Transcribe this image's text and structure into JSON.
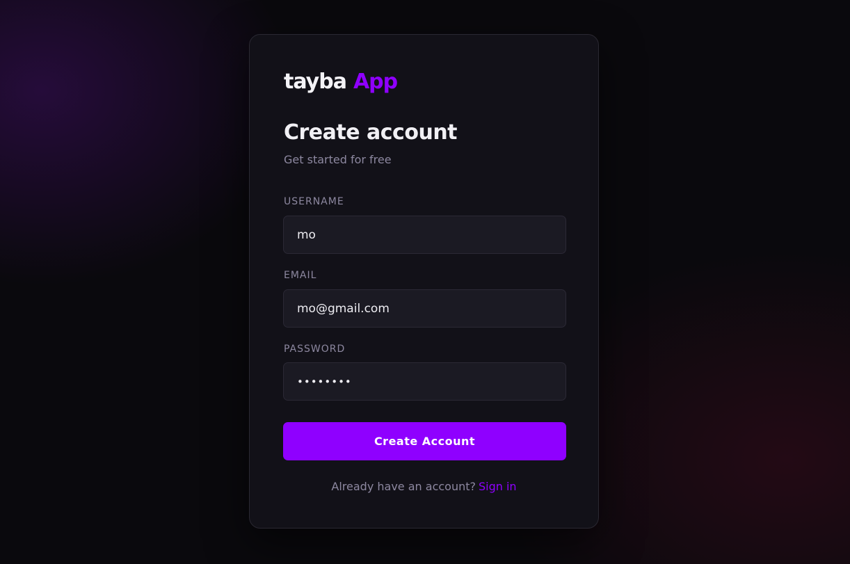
{
  "brand": {
    "name_part1": "tayba",
    "name_part2": "App",
    "accent_color": "#8f00ff"
  },
  "form": {
    "title": "Create account",
    "subtitle": "Get started for free",
    "fields": {
      "username": {
        "label": "USERNAME",
        "value": "mo"
      },
      "email": {
        "label": "EMAIL",
        "value": "mo@gmail.com"
      },
      "password": {
        "label": "PASSWORD",
        "value": "••••••••"
      }
    },
    "submit_label": "Create Account"
  },
  "footer": {
    "prompt": "Already have an account?",
    "link_label": "Sign in"
  }
}
